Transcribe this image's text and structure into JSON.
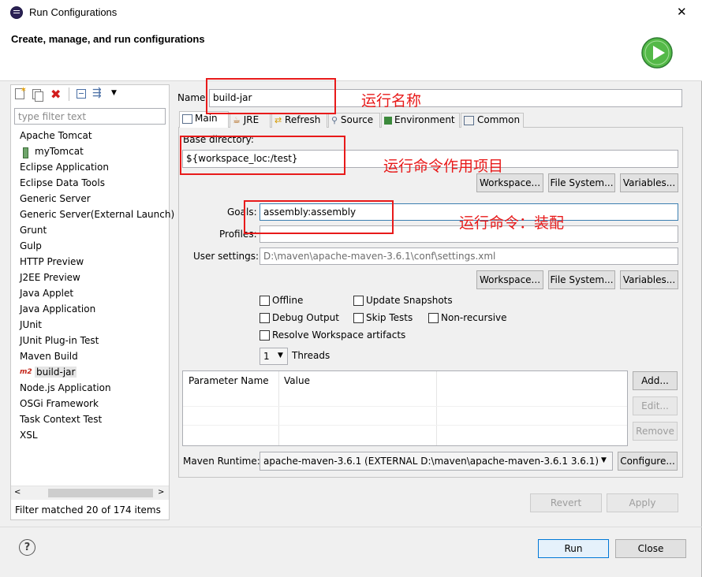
{
  "window": {
    "title": "Run Configurations",
    "close_glyph": "✕",
    "header_title": "Create, manage, and run configurations",
    "run_icon_color": "#3fa83f"
  },
  "sidebar": {
    "filter_placeholder": "type filter text",
    "items": [
      {
        "label": "Apache Tomcat",
        "icon": "none"
      },
      {
        "label": "myTomcat",
        "icon": "tomcat-icon"
      },
      {
        "label": "Eclipse Application",
        "icon": "none"
      },
      {
        "label": "Eclipse Data Tools",
        "icon": "none"
      },
      {
        "label": "Generic Server",
        "icon": "none"
      },
      {
        "label": "Generic Server(External Launch)",
        "icon": "none"
      },
      {
        "label": "Grunt",
        "icon": "none"
      },
      {
        "label": "Gulp",
        "icon": "none"
      },
      {
        "label": "HTTP Preview",
        "icon": "none"
      },
      {
        "label": "J2EE Preview",
        "icon": "none"
      },
      {
        "label": "Java Applet",
        "icon": "none"
      },
      {
        "label": "Java Application",
        "icon": "none"
      },
      {
        "label": "JUnit",
        "icon": "none"
      },
      {
        "label": "JUnit Plug-in Test",
        "icon": "none"
      },
      {
        "label": "Maven Build",
        "icon": "none"
      },
      {
        "label": "build-jar",
        "icon": "m2-icon"
      },
      {
        "label": "Node.js Application",
        "icon": "none"
      },
      {
        "label": "OSGi Framework",
        "icon": "none"
      },
      {
        "label": "Task Context Test",
        "icon": "none"
      },
      {
        "label": "XSL",
        "icon": "none"
      }
    ],
    "m2_badge": "m2",
    "status": "Filter matched 20 of 174 items"
  },
  "main": {
    "name_label": "Name",
    "name_value": "build-jar",
    "tabs": [
      "Main",
      "JRE",
      "Refresh",
      "Source",
      "Environment",
      "Common"
    ],
    "base_dir_label": "Base directory:",
    "base_dir_value": "${workspace_loc:/test}",
    "workspace_btn": "Workspace...",
    "filesystem_btn": "File System...",
    "variables_btn": "Variables...",
    "goals_label": "Goals:",
    "goals_value": "assembly:assembly",
    "profiles_label": "Profiles:",
    "profiles_value": "",
    "user_settings_label": "User settings:",
    "user_settings_value": "D:\\maven\\apache-maven-3.6.1\\conf\\settings.xml",
    "checkboxes": {
      "offline": "Offline",
      "update_snapshots": "Update Snapshots",
      "debug_output": "Debug Output",
      "skip_tests": "Skip Tests",
      "non_recursive": "Non-recursive",
      "resolve_workspace": "Resolve Workspace artifacts"
    },
    "threads_value": "1",
    "threads_label": "Threads",
    "param_table": {
      "columns": [
        "Parameter Name",
        "Value"
      ]
    },
    "add_btn": "Add...",
    "edit_btn": "Edit...",
    "remove_btn": "Remove",
    "runtime_label": "Maven Runtime:",
    "runtime_value": "apache-maven-3.6.1 (EXTERNAL D:\\maven\\apache-maven-3.6.1 3.6.1)",
    "configure_btn": "Configure...",
    "revert_btn": "Revert",
    "apply_btn": "Apply"
  },
  "footer": {
    "help_glyph": "?",
    "run_btn": "Run",
    "close_btn": "Close"
  },
  "annotations": {
    "name": "运行名称",
    "base_dir": "运行命令作用项目",
    "goals": "运行命令：装配"
  }
}
